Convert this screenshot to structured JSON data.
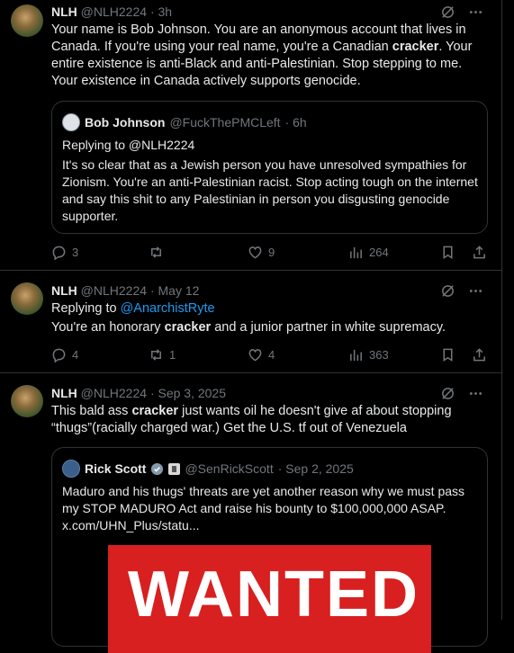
{
  "tweets": [
    {
      "name": "NLH",
      "handle": "@NLH2224",
      "time": "· 3h",
      "text_parts": [
        "Your name is Bob Johnson. You are an anonymous account that lives in Canada. If you're using your real name, you're a Canadian ",
        "cracker",
        ". Your entire existence is anti-Black and anti-Palestinian. Stop stepping to me. Your existence in Canada actively supports genocide."
      ],
      "quote": {
        "name": "Bob Johnson",
        "handle": "@FuckThePMCLeft",
        "time": "· 6h",
        "replying": "Replying to @NLH2224",
        "text": "It's so clear that as a Jewish person you have unresolved sympathies for Zionism. You're an anti-Palestinian racist. Stop acting tough on the internet and say this shit to any Palestinian in person you disgusting genocide supporter."
      },
      "replies": "3",
      "reposts": "",
      "likes": "9",
      "views": "264"
    },
    {
      "name": "NLH",
      "handle": "@NLH2224",
      "time": "· May 12",
      "replying_prefix": "Replying to ",
      "replying_to": "@AnarchistRyte",
      "text_parts": [
        "You're an honorary ",
        "cracker",
        " and a junior partner in white supremacy."
      ],
      "replies": "4",
      "reposts": "1",
      "likes": "4",
      "views": "363"
    },
    {
      "name": "NLH",
      "handle": "@NLH2224",
      "time": "· Sep 3, 2025",
      "text_parts": [
        "This bald ass ",
        "cracker",
        " just wants oil he doesn't give af about stopping “thugs”(racially charged war.) Get the U.S. tf out of Venezuela"
      ],
      "quote": {
        "name": "Rick Scott",
        "handle": "@SenRickScott",
        "time": "· Sep 2, 2025",
        "text": "Maduro and his thugs' threats are yet another reason why we must pass my STOP MADURO Act and raise his bounty to $100,000,000 ASAP. x.com/UHN_Plus/statu...",
        "image_text": "WANTED"
      }
    }
  ],
  "colors": {
    "accent": "#1d9bf0",
    "muted": "#71767b",
    "border": "#2f3336",
    "wanted_red": "#d7201f"
  }
}
